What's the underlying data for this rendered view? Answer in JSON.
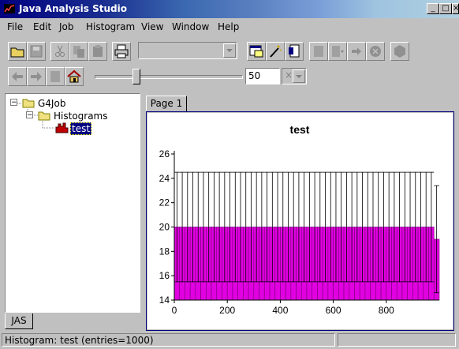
{
  "window": {
    "title": "Java Analysis Studio"
  },
  "menu": {
    "items": [
      {
        "label": "File",
        "mnemonic": "F"
      },
      {
        "label": "Edit",
        "mnemonic": "E"
      },
      {
        "label": "Job",
        "mnemonic": "J"
      },
      {
        "label": "Histogram",
        "mnemonic": "H"
      },
      {
        "label": "View",
        "mnemonic": "V"
      },
      {
        "label": "Window",
        "mnemonic": "W"
      },
      {
        "label": "Help",
        "mnemonic": "H"
      }
    ]
  },
  "toolbar": {
    "combo_value": "",
    "slider_value": "50",
    "slider_fraction": 0.27
  },
  "tree": {
    "root": "G4Job",
    "folder": "Histograms",
    "leaf": "test"
  },
  "left_tab": "JAS",
  "page_tab": "Page 1",
  "status": {
    "text": "Histogram: test (entries=1000)"
  },
  "chart_data": {
    "type": "bar",
    "title": "test",
    "xlabel": "",
    "ylabel": "",
    "xlim": [
      0,
      1000
    ],
    "ylim": [
      14,
      26
    ],
    "xticks": [
      "0",
      "200",
      "400",
      "600",
      "800"
    ],
    "yticks": [
      "14",
      "16",
      "18",
      "20",
      "22",
      "24",
      "26"
    ],
    "bins": 50,
    "bin_width": 20,
    "values": [
      20,
      20,
      20,
      20,
      20,
      20,
      20,
      20,
      20,
      20,
      20,
      20,
      20,
      20,
      20,
      20,
      20,
      20,
      20,
      20,
      20,
      20,
      20,
      20,
      20,
      20,
      20,
      20,
      20,
      20,
      20,
      20,
      20,
      20,
      20,
      20,
      20,
      20,
      20,
      20,
      20,
      20,
      20,
      20,
      20,
      20,
      20,
      20,
      20,
      19
    ],
    "error_high": 24.5,
    "error_low": 15.5,
    "last_error_high": 23.4,
    "last_error_low": 14.6,
    "colors": {
      "fill": "#e000e0",
      "edge": "#7a007a"
    },
    "legend": "none",
    "grid": false
  }
}
